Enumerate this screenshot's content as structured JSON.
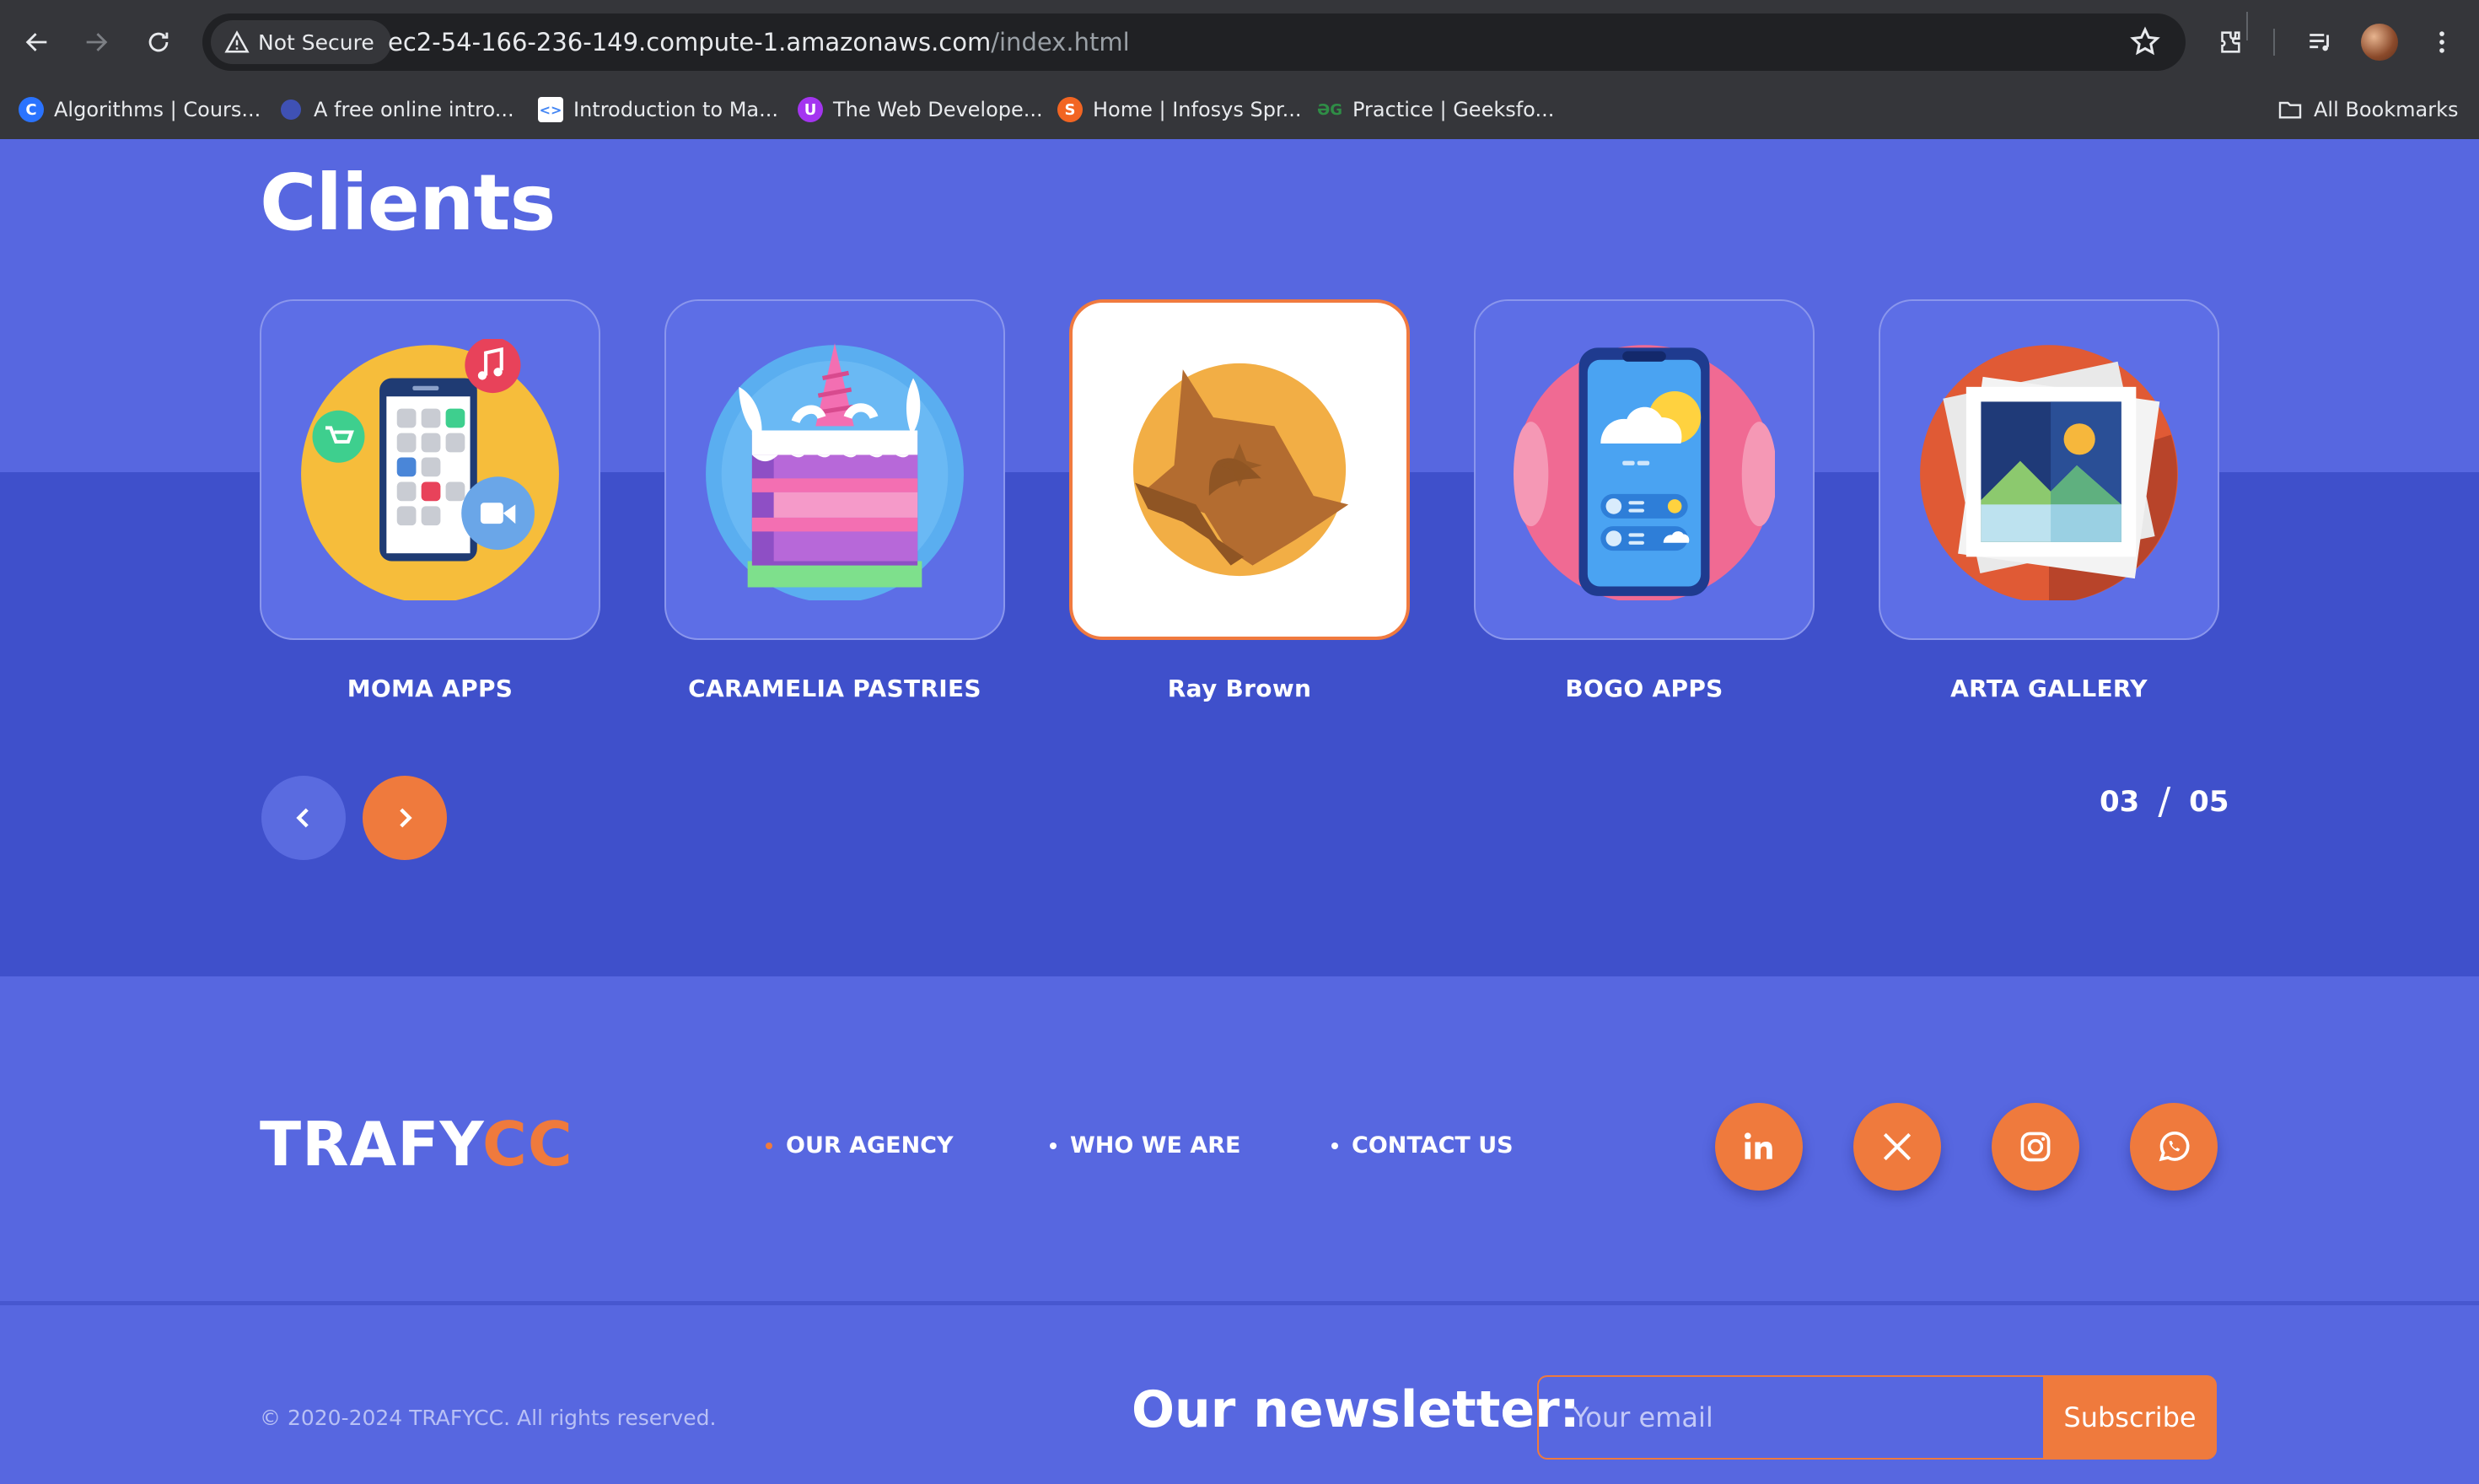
{
  "browser": {
    "security_label": "Not Secure",
    "url_host": "ec2-54-166-236-149.compute-1.amazonaws.com",
    "url_path": "/index.html",
    "bookmarks": [
      {
        "label": "Algorithms | Cours...",
        "icon": "coursera-icon",
        "color": "#2a73ff"
      },
      {
        "label": "A free online intro...",
        "icon": "dot-icon",
        "color": "#3f51b5"
      },
      {
        "label": "Introduction to Ma...",
        "icon": "code-icon",
        "color": "#ffffff"
      },
      {
        "label": "The Web Develope...",
        "icon": "udemy-icon",
        "color": "#a435f0"
      },
      {
        "label": "Home | Infosys Spr...",
        "icon": "infosys-icon",
        "color": "#f26522"
      },
      {
        "label": "Practice | Geeksfo...",
        "icon": "geeksforgeeks-icon",
        "color": "#2f8d46"
      }
    ],
    "all_bookmarks_label": "All Bookmarks"
  },
  "clients": {
    "title": "Clients",
    "items": [
      {
        "label": "MOMA APPS",
        "icon": "mobile-apps-icon",
        "active": false
      },
      {
        "label": "CARAMELIA PASTRIES",
        "icon": "unicorn-cake-icon",
        "active": false
      },
      {
        "label": "Ray Brown",
        "icon": "fox-icon",
        "active": true
      },
      {
        "label": "BOGO APPS",
        "icon": "weather-phone-icon",
        "active": false
      },
      {
        "label": "ARTA GALLERY",
        "icon": "picture-gallery-icon",
        "active": false
      }
    ],
    "pager": {
      "current": "03",
      "separator": "/",
      "total": "05"
    }
  },
  "footer": {
    "logo_part1": "TRAFY",
    "logo_part2": "CC",
    "links": [
      "OUR AGENCY",
      "WHO WE ARE",
      "CONTACT US"
    ],
    "social": [
      "linkedin-icon",
      "x-icon",
      "instagram-icon",
      "whatsapp-icon"
    ],
    "copyright": "© 2020-2024 TRAFYCC. All rights reserved.",
    "newsletter_title": "Our newsletter:",
    "email_placeholder": "Your email",
    "subscribe_label": "Subscribe"
  },
  "colors": {
    "page_bg": "#5767e0",
    "band_dark": "#3f50cb",
    "accent": "#ef7a3d"
  }
}
